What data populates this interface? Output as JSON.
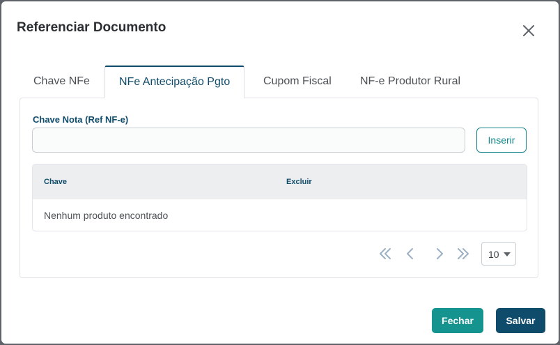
{
  "dialog": {
    "title": "Referenciar Documento"
  },
  "tabs": [
    {
      "label": "Chave NFe",
      "active": false
    },
    {
      "label": "NFe Antecipação Pgto",
      "active": true
    },
    {
      "label": "Cupom Fiscal",
      "active": false
    },
    {
      "label": "NF-e Produtor Rural",
      "active": false
    }
  ],
  "form": {
    "chave_label": "Chave Nota (Ref NF-e)",
    "chave_value": "",
    "inserir_label": "Inserir"
  },
  "table": {
    "columns": [
      "Chave",
      "Excluir"
    ],
    "empty_message": "Nenhum produto encontrado"
  },
  "pagination": {
    "page_size": "10",
    "icons": [
      "first-page-icon",
      "previous-page-icon",
      "next-page-icon",
      "last-page-icon"
    ]
  },
  "footer": {
    "fechar_label": "Fechar",
    "salvar_label": "Salvar"
  },
  "colors": {
    "primary": "#0f4c6b",
    "accent": "#14938f"
  }
}
